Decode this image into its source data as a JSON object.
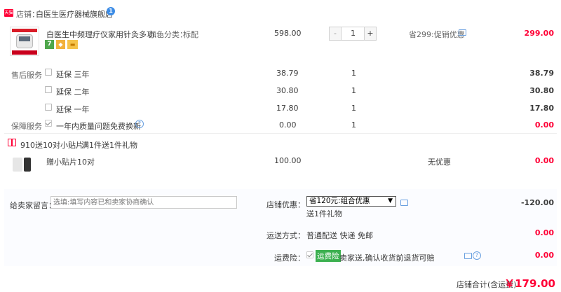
{
  "shop": {
    "badge": "天猫",
    "prefix": "店铺：",
    "name": "白医生医疗器械旗舰店",
    "wangwang_icon": "wangwang-chat-icon"
  },
  "product": {
    "thumb_caption": "白医生",
    "thumb_sub": "DMS低频理疗仪",
    "title": "白医生中频理疗仪家用针灸多功...",
    "sku_label": "颜色分类：",
    "sku_value": "标配",
    "unit_price": "598.00",
    "qty": "1",
    "qty_minus": "-",
    "qty_plus": "+",
    "promo": "省299:促销优惠",
    "subtotal": "299.00",
    "service_badges": [
      "7",
      "◆",
      "▬"
    ]
  },
  "after_sales": {
    "label": "售后服务",
    "items": [
      {
        "name": "延保 三年",
        "price": "38.79",
        "qty": "1",
        "total": "38.79"
      },
      {
        "name": "延保 二年",
        "price": "30.80",
        "qty": "1",
        "total": "30.80"
      },
      {
        "name": "延保 一年",
        "price": "17.80",
        "qty": "1",
        "total": "17.80"
      }
    ]
  },
  "guarantee": {
    "label": "保障服务",
    "name": "一年内质量问题免费换新",
    "price": "0.00",
    "qty": "1",
    "total": "0.00"
  },
  "gift_promo": {
    "text": "910送10对小贴片",
    "sub": "满1件送1件礼物"
  },
  "gift_item": {
    "name": "赠小贴片10对",
    "price": "100.00",
    "promo": "无优惠",
    "total": "0.00"
  },
  "message": {
    "label": "给卖家留言：",
    "placeholder": "选填:填写内容已和卖家协商确认"
  },
  "shop_discount": {
    "label": "店铺优惠：",
    "selected": "省120元:组合优惠",
    "note": "送1件礼物",
    "amount": "-120.00"
  },
  "shipping": {
    "label": "运送方式：",
    "value": "普通配送 快递 免邮",
    "amount": "0.00"
  },
  "insurance": {
    "label": "运费险：",
    "badge": "运费险",
    "text": "卖家送,确认收货前退货可赔",
    "amount": "0.00"
  },
  "total": {
    "label": "店铺合计(含运费)",
    "amount": "￥179.00"
  },
  "colors": {
    "accent": "#ff0036",
    "panel_bg": "#fbfcff",
    "insurance_green": "#3cb050",
    "info_blue": "#3c8ce6"
  }
}
